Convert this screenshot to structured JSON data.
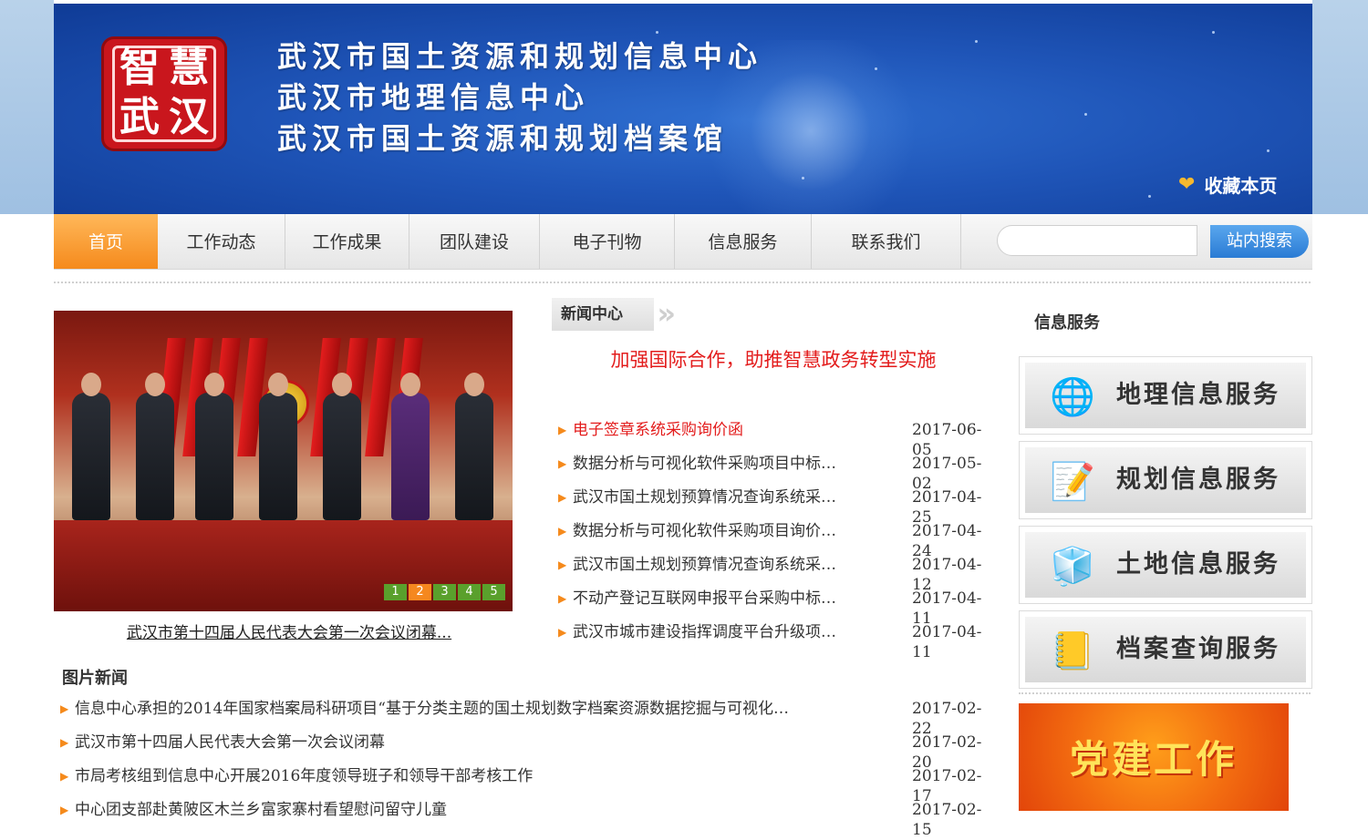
{
  "header": {
    "titles": [
      "武汉市国土资源和规划信息中心",
      "武汉市地理信息中心",
      "武汉市国土资源和规划档案馆"
    ],
    "logo_chars": [
      "智",
      "慧",
      "武",
      "汉"
    ],
    "favorite_label": "收藏本页",
    "favorite_icon": "heart-icon"
  },
  "nav": {
    "items": [
      "首页",
      "工作动态",
      "工作成果",
      "团队建设",
      "电子刊物",
      "信息服务",
      "联系我们"
    ],
    "active_index": 0,
    "search_placeholder": "",
    "search_button": "站内搜索"
  },
  "slideshow": {
    "caption": "武汉市第十四届人民代表大会第一次会议闭幕...",
    "pages": [
      "1",
      "2",
      "3",
      "4",
      "5"
    ],
    "active_page": "2"
  },
  "news_center": {
    "tab_label": "新闻中心",
    "headline": "加强国际合作，助推智慧政务转型实施",
    "items": [
      {
        "title": "电子签章系统采购询价函",
        "date": "2017-06-05",
        "highlight": true
      },
      {
        "title": "数据分析与可视化软件采购项目中标…",
        "date": "2017-05-02"
      },
      {
        "title": "武汉市国土规划预算情况查询系统采…",
        "date": "2017-04-25"
      },
      {
        "title": "数据分析与可视化软件采购项目询价…",
        "date": "2017-04-24"
      },
      {
        "title": "武汉市国土规划预算情况查询系统采…",
        "date": "2017-04-12"
      },
      {
        "title": "不动产登记互联网申报平台采购中标…",
        "date": "2017-04-11"
      },
      {
        "title": "武汉市城市建设指挥调度平台升级项…",
        "date": "2017-04-11"
      }
    ]
  },
  "picture_news": {
    "title": "图片新闻",
    "items": [
      {
        "title": "信息中心承担的2014年国家档案局科研项目“基于分类主题的国土规划数字档案资源数据挖掘与可视化…",
        "date": "2017-02-22"
      },
      {
        "title": "武汉市第十四届人民代表大会第一次会议闭幕",
        "date": "2017-02-20"
      },
      {
        "title": "市局考核组到信息中心开展2016年度领导班子和领导干部考核工作",
        "date": "2017-02-17"
      },
      {
        "title": "中心团支部赴黄陂区木兰乡富家寨村看望慰问留守儿童",
        "date": "2017-02-15"
      }
    ]
  },
  "info_services": {
    "title": "信息服务",
    "items": [
      {
        "label": "地理信息服务",
        "icon": "globe-monitor-icon"
      },
      {
        "label": "规划信息服务",
        "icon": "pencil-note-icon"
      },
      {
        "label": "土地信息服务",
        "icon": "cubes-icon"
      },
      {
        "label": "档案查询服务",
        "icon": "archive-book-icon"
      }
    ],
    "party_banner": "党建工作"
  },
  "colors": {
    "accent_orange": "#f58a1c",
    "headline_red": "#e31c1c",
    "banner_blue": "#1f55b8",
    "search_blue": "#2a7bd4"
  }
}
